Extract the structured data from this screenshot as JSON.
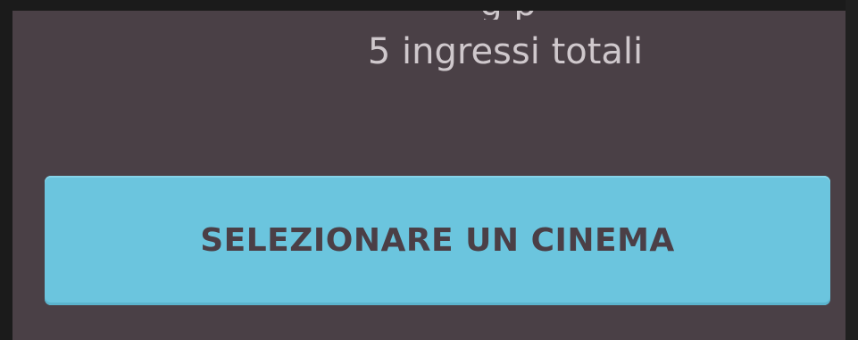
{
  "panel": {
    "cut_text": "g  p",
    "entries_text": "5 ingressi totali",
    "cta_label": "SELEZIONARE UN CINEMA"
  },
  "colors": {
    "page_bg": "#1b1b1b",
    "panel_bg": "#4a4046",
    "text": "#cfc8cc",
    "button_bg": "#6bc5de",
    "button_text": "#4b3f46"
  }
}
